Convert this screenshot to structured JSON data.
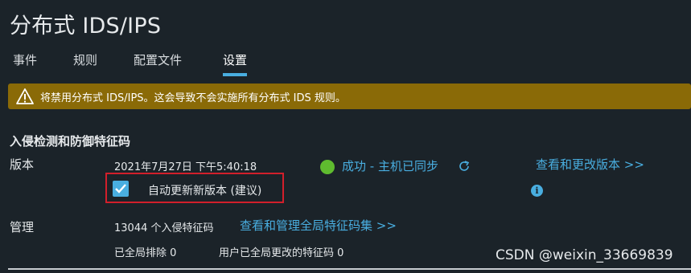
{
  "page": {
    "title": "分布式 IDS/IPS"
  },
  "tabs": [
    {
      "label": "事件"
    },
    {
      "label": "规则"
    },
    {
      "label": "配置文件"
    },
    {
      "label": "设置"
    }
  ],
  "banner": {
    "message": "将禁用分布式 IDS/IPS。这会导致不会实施所有分布式 IDS 规则。"
  },
  "section": {
    "title": "入侵检测和防御特征码",
    "version_label": "版本",
    "version_timestamp": "2021年7月27日 下午5:40:18",
    "status_text": "成功 - 主机已同步",
    "view_change_link": "查看和更改版本 >>",
    "auto_update_label": "自动更新新版本 (建议)",
    "auto_update_checked": true,
    "manage_label": "管理",
    "signature_count": "13044 个入侵特征码",
    "manage_link": "查看和管理全局特征码集 >>",
    "global_excluded": "已全局排除  0",
    "user_changed": "用户已全局更改的特征码  0"
  },
  "watermark": "CSDN @weixin_33669839",
  "colors": {
    "background": "#1b2329",
    "accent": "#49aee0",
    "warning": "#8a6a07",
    "success": "#5fbb2f",
    "highlight": "#d21f2b"
  }
}
